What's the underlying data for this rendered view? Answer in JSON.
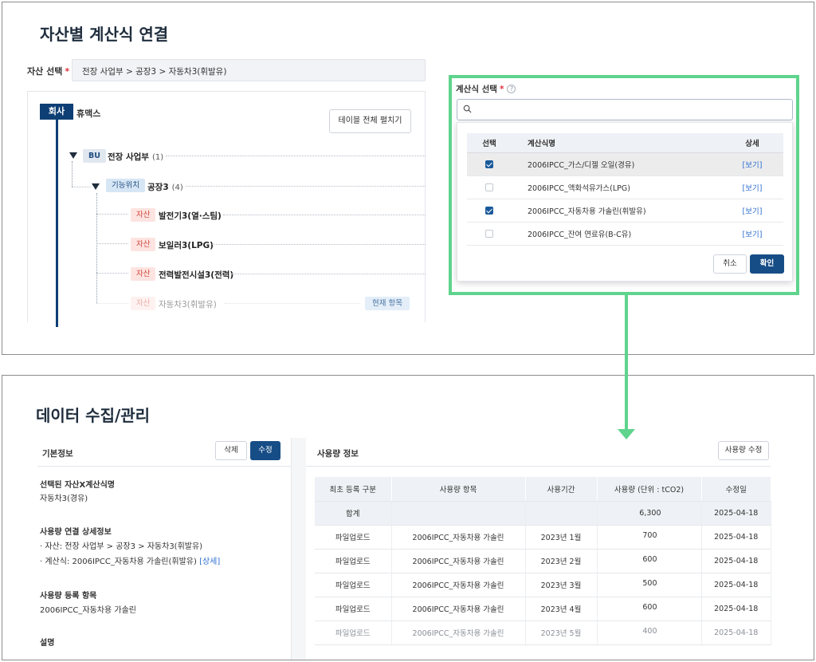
{
  "top": {
    "title": "자산별 계산식 연결",
    "asset_label": "자산 선택",
    "required_mark": "*",
    "asset_path": "전장 사업부 > 공장3 > 자동차3(휘발유)",
    "expand_button": "테이블 전체 펼치기",
    "tree": {
      "company_badge": "회사",
      "company_name": "휴맥스",
      "bu_badge": "BU",
      "bu_name": "전장 사업부",
      "bu_count": "(1)",
      "pos_badge": "기능위치",
      "pos_name": "공장3",
      "pos_count": "(4)",
      "asset_badge": "자산",
      "assets": [
        "발전기3(열·스팀)",
        "보일러3(LPG)",
        "전력발전시설3(전력)",
        "자동차3(휘발유)"
      ],
      "current_tag": "현재 항목"
    },
    "formula": {
      "label": "계산식 선택",
      "help": "?",
      "search_placeholder": "",
      "headers": {
        "select": "선택",
        "name": "계산식명",
        "detail": "상세"
      },
      "rows": [
        {
          "name": "2006IPCC_가스/디젤 오일(경유)",
          "checked": true,
          "link": "[보기]"
        },
        {
          "name": "2006IPCC_액화석유가스(LPG)",
          "checked": false,
          "link": "[보기]"
        },
        {
          "name": "2006IPCC_자동차용 가솔린(휘발유)",
          "checked": true,
          "link": "[보기]"
        },
        {
          "name": "2006IPCC_잔여 연료유(B-C유)",
          "checked": false,
          "link": "[보기]"
        }
      ],
      "cancel": "취소",
      "confirm": "확인"
    },
    "colors": {
      "accent": "#0e3f74",
      "highlight": "#5ed48c"
    }
  },
  "bottom": {
    "title": "데이터 수집/관리",
    "basic_info": "기본정보",
    "delete": "삭제",
    "edit": "수정",
    "sel_label": "선택된 자산X계산식명",
    "sel_value": "자동차3(경유)",
    "link_label": "사용량 연결 상세정보",
    "link_asset": "· 자산: 전장 사업부 > 공장3 > 자동차3(휘발유)",
    "link_formula": "· 계산식: 2006IPCC_자동차용 가솔린(휘발유)",
    "link_detail": "[상세]",
    "reg_label": "사용량 등록 항목",
    "reg_value": "2006IPCC_자동차용 가솔린",
    "desc_label": "설명",
    "usage_title": "사용량 정보",
    "usage_edit": "사용량 수정",
    "usage_headers": [
      "최초 등록 구분",
      "사용량 항목",
      "사용기간",
      "사용량 (단위 : tCO2)",
      "수정일"
    ],
    "usage_sum": {
      "label": "합계",
      "value": "6,300",
      "date": "2025-04-18"
    },
    "usage_rows": [
      {
        "type": "파일업로드",
        "item": "2006IPCC_자동차용 가솔린",
        "period": "2023년 1월",
        "amount": "700",
        "date": "2025-04-18"
      },
      {
        "type": "파일업로드",
        "item": "2006IPCC_자동차용 가솔린",
        "period": "2023년 2월",
        "amount": "600",
        "date": "2025-04-18"
      },
      {
        "type": "파일업로드",
        "item": "2006IPCC_자동차용 가솔린",
        "period": "2023년 3월",
        "amount": "500",
        "date": "2025-04-18"
      },
      {
        "type": "파일업로드",
        "item": "2006IPCC_자동차용 가솔린",
        "period": "2023년 4월",
        "amount": "600",
        "date": "2025-04-18"
      },
      {
        "type": "파일업로드",
        "item": "2006IPCC_자동차용 가솔린",
        "period": "2023년 5월",
        "amount": "400",
        "date": "2025-04-18"
      }
    ]
  }
}
